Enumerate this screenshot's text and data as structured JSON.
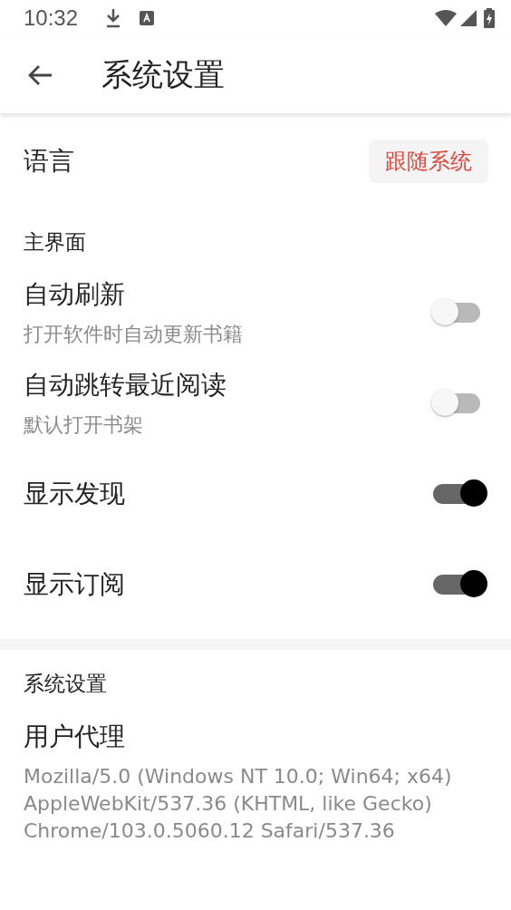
{
  "status_bar": {
    "time": "10:32"
  },
  "app_bar": {
    "title": "系统设置"
  },
  "language": {
    "label": "语言",
    "value": "跟随系统"
  },
  "sections": [
    {
      "title": "主界面",
      "items": [
        {
          "kind": "toggle",
          "title": "自动刷新",
          "subtitle": "打开软件时自动更新书籍",
          "on": false
        },
        {
          "kind": "toggle",
          "title": "自动跳转最近阅读",
          "subtitle": "默认打开书架",
          "on": false
        },
        {
          "kind": "toggle",
          "title": "显示发现",
          "on": true
        },
        {
          "kind": "toggle",
          "title": "显示订阅",
          "on": true
        }
      ]
    },
    {
      "title": "系统设置",
      "items": [
        {
          "kind": "text",
          "title": "用户代理",
          "subtitle": "Mozilla/5.0 (Windows NT 10.0; Win64; x64) AppleWebKit/537.36 (KHTML, like Gecko) Chrome/103.0.5060.12 Safari/537.36"
        }
      ]
    }
  ]
}
